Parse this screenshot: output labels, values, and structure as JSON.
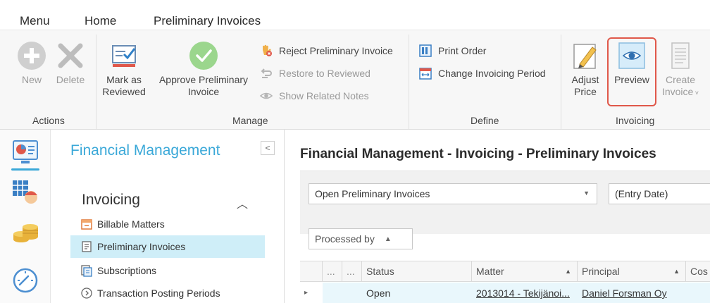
{
  "menu": {
    "tabs": [
      {
        "label": "Menu"
      },
      {
        "label": "Home"
      },
      {
        "label": "Preliminary Invoices",
        "active": true
      }
    ]
  },
  "ribbon": {
    "actions": {
      "new_label": "New",
      "delete_label": "Delete",
      "group_label": "Actions"
    },
    "manage": {
      "mark_reviewed_line1": "Mark as",
      "mark_reviewed_line2": "Reviewed",
      "approve_line1": "Approve Preliminary",
      "approve_line2": "Invoice",
      "reject_label": "Reject Preliminary Invoice",
      "restore_label": "Restore to Reviewed",
      "show_notes_label": "Show Related Notes",
      "group_label": "Manage"
    },
    "define": {
      "print_order_label": "Print Order",
      "change_period_label": "Change Invoicing Period",
      "group_label": "Define"
    },
    "invoicing": {
      "adjust_line1": "Adjust",
      "adjust_line2": "Price",
      "preview_label": "Preview",
      "create_line1": "Create",
      "create_line2": "Invoice",
      "group_label": "Invoicing"
    }
  },
  "nav": {
    "title": "Financial Management",
    "collapse_glyph": "<",
    "section": "Invoicing",
    "items": [
      {
        "label": "Billable Matters"
      },
      {
        "label": "Preliminary Invoices",
        "selected": true
      },
      {
        "label": "Subscriptions"
      },
      {
        "label": "Transaction Posting Periods"
      }
    ]
  },
  "main": {
    "header": "Financial Management - Invoicing - Preliminary Invoices",
    "filter_view": "Open Preliminary Invoices",
    "filter_date": "(Entry Date)",
    "group_by": "Processed by",
    "columns": {
      "c1": "...",
      "c2": "...",
      "status": "Status",
      "matter": "Matter",
      "principal": "Principal",
      "cost": "Cos"
    },
    "row": {
      "status": "Open",
      "matter": "2013014 - Tekijänoi...",
      "principal": "Daniel Forsman Oy"
    }
  },
  "colors": {
    "accent": "#3aa8d8",
    "highlight_border": "#e0584a",
    "selected_row": "#cfeef8"
  }
}
